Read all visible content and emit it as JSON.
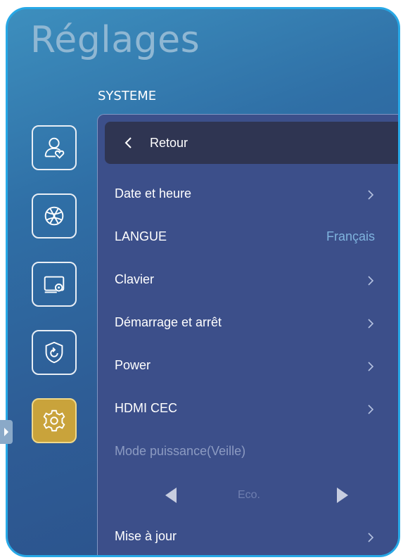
{
  "header": {
    "title": "Réglages",
    "section": "SYSTEME"
  },
  "sidebar": [
    {
      "icon": "user-heart-icon"
    },
    {
      "icon": "globe-icon"
    },
    {
      "icon": "display-settings-icon"
    },
    {
      "icon": "shield-refresh-icon"
    },
    {
      "icon": "gear-icon",
      "active": true
    }
  ],
  "panel": {
    "back_label": "Retour",
    "items": [
      {
        "label": "Date et heure"
      },
      {
        "label": "LANGUE",
        "value": "Français"
      },
      {
        "label": "Clavier"
      },
      {
        "label": "Démarrage et arrêt"
      },
      {
        "label": "Power"
      },
      {
        "label": "HDMI CEC"
      },
      {
        "label": "Mode puissance(Veille)"
      },
      {
        "label": "Mise à jour"
      }
    ],
    "power_mode_value": "Eco."
  },
  "colors": {
    "accent_border": "#27a8e6",
    "active_tile": "#c9a33b",
    "value_text": "#7fb3de"
  }
}
